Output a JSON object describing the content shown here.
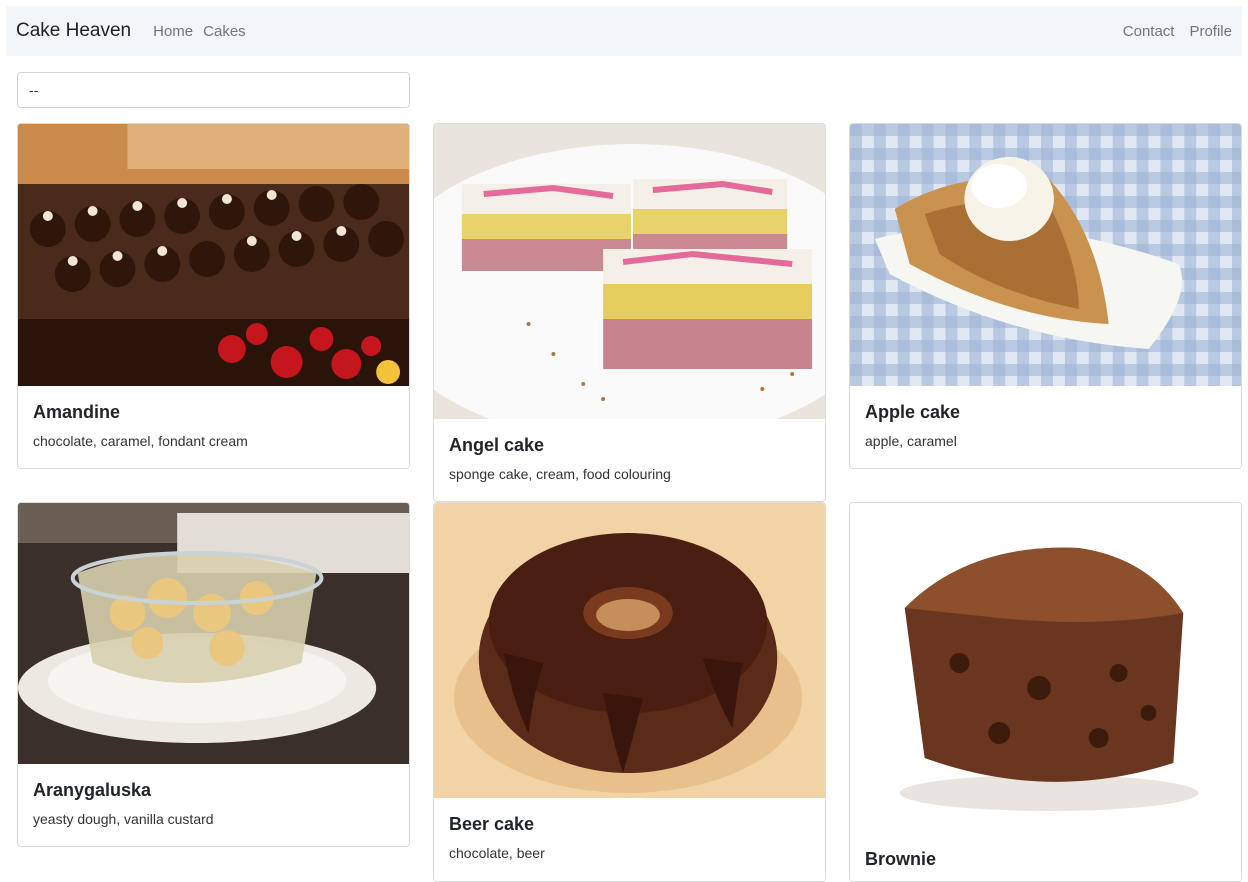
{
  "nav": {
    "brand": "Cake Heaven",
    "left_links": [
      "Home",
      "Cakes"
    ],
    "right_links": [
      "Contact",
      "Profile"
    ]
  },
  "filter": {
    "value": "--"
  },
  "cakes": [
    {
      "name": "Amandine",
      "ingredients": "chocolate, caramel, fondant cream"
    },
    {
      "name": "Angel cake",
      "ingredients": "sponge cake, cream, food colouring"
    },
    {
      "name": "Apple cake",
      "ingredients": "apple, caramel"
    },
    {
      "name": "Aranygaluska",
      "ingredients": "yeasty dough, vanilla custard"
    },
    {
      "name": "Beer cake",
      "ingredients": "chocolate, beer"
    },
    {
      "name": "Brownie",
      "ingredients": ""
    }
  ]
}
